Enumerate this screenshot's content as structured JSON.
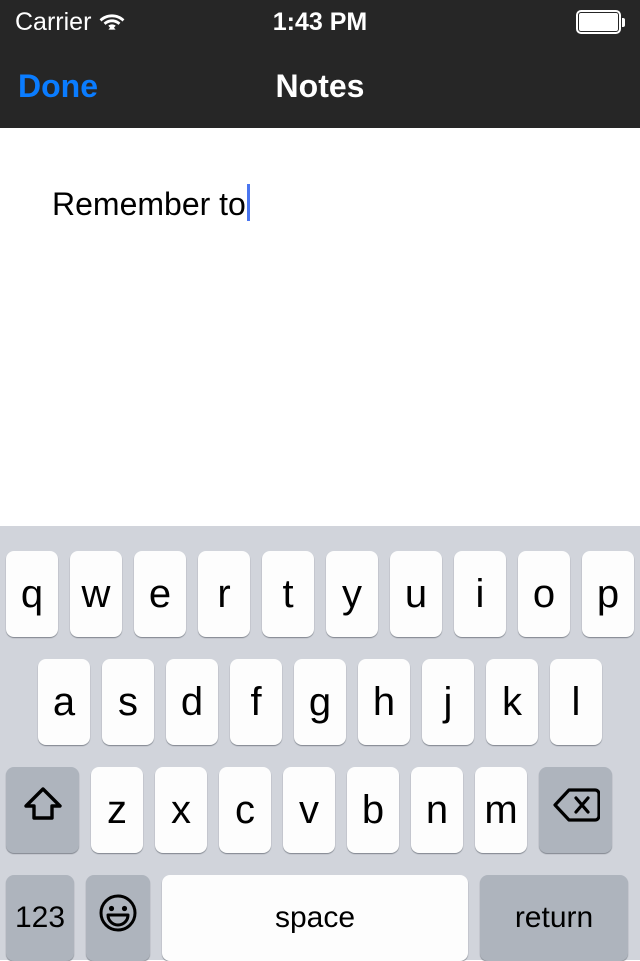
{
  "status_bar": {
    "carrier": "Carrier",
    "wifi_icon": "wifi-icon",
    "time": "1:43 PM",
    "battery_icon": "battery-full-icon",
    "background_color": "#262626",
    "text_color": "#ffffff"
  },
  "nav_bar": {
    "left_button": "Done",
    "title": "Notes",
    "accent_color": "#0a7cff",
    "background_color": "#262626"
  },
  "note": {
    "text": "Remember to",
    "caret_color": "#4a76f0",
    "text_color": "#000000",
    "background_color": "#ffffff"
  },
  "keyboard": {
    "background_color": "#d1d4db",
    "key_color": "#fdfdfd",
    "special_key_color": "#aeb4bd",
    "rows": [
      {
        "keys": [
          {
            "label": "q",
            "name": "key-q"
          },
          {
            "label": "w",
            "name": "key-w"
          },
          {
            "label": "e",
            "name": "key-e"
          },
          {
            "label": "r",
            "name": "key-r"
          },
          {
            "label": "t",
            "name": "key-t"
          },
          {
            "label": "y",
            "name": "key-y"
          },
          {
            "label": "u",
            "name": "key-u"
          },
          {
            "label": "i",
            "name": "key-i"
          },
          {
            "label": "o",
            "name": "key-o"
          },
          {
            "label": "p",
            "name": "key-p"
          }
        ]
      },
      {
        "keys": [
          {
            "label": "a",
            "name": "key-a"
          },
          {
            "label": "s",
            "name": "key-s"
          },
          {
            "label": "d",
            "name": "key-d"
          },
          {
            "label": "f",
            "name": "key-f"
          },
          {
            "label": "g",
            "name": "key-g"
          },
          {
            "label": "h",
            "name": "key-h"
          },
          {
            "label": "j",
            "name": "key-j"
          },
          {
            "label": "k",
            "name": "key-k"
          },
          {
            "label": "l",
            "name": "key-l"
          }
        ]
      },
      {
        "keys": [
          {
            "label": "",
            "name": "key-shift",
            "icon": "shift-arrow-icon"
          },
          {
            "label": "z",
            "name": "key-z"
          },
          {
            "label": "x",
            "name": "key-x"
          },
          {
            "label": "c",
            "name": "key-c"
          },
          {
            "label": "v",
            "name": "key-v"
          },
          {
            "label": "b",
            "name": "key-b"
          },
          {
            "label": "n",
            "name": "key-n"
          },
          {
            "label": "m",
            "name": "key-m"
          },
          {
            "label": "",
            "name": "key-backspace",
            "icon": "backspace-delete-icon"
          }
        ]
      },
      {
        "keys": [
          {
            "label": "123",
            "name": "key-numbers"
          },
          {
            "label": "",
            "name": "key-emoji",
            "icon": "smiley-face-icon"
          },
          {
            "label": "space",
            "name": "key-space"
          },
          {
            "label": "return",
            "name": "key-return"
          }
        ]
      }
    ]
  }
}
